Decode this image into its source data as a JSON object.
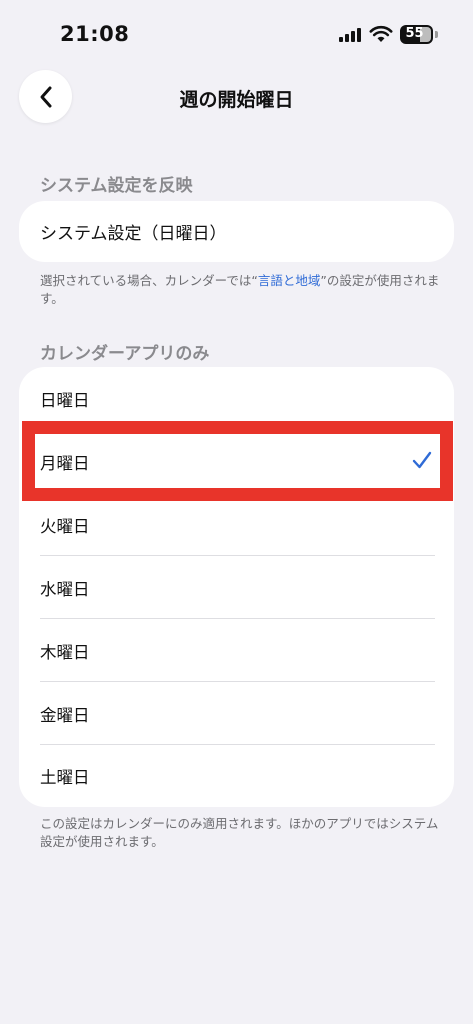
{
  "status": {
    "time": "21:08",
    "battery": "55"
  },
  "nav": {
    "title": "週の開始曜日"
  },
  "system_section": {
    "header": "システム設定を反映",
    "option": "システム設定（日曜日）",
    "footnote_before": "選択されている場合、カレンダーでは“",
    "footnote_link": "言語と地域",
    "footnote_after": "”の設定が使用されます。"
  },
  "calendar_section": {
    "header": "カレンダーアプリのみ",
    "days": [
      "日曜日",
      "月曜日",
      "火曜日",
      "水曜日",
      "木曜日",
      "金曜日",
      "土曜日"
    ],
    "selected": "月曜日",
    "footnote": "この設定はカレンダーにのみ適用されます。ほかのアプリではシステム設定が使用されます。"
  },
  "colors": {
    "accent": "#2f6bd6",
    "highlight": "#e8342a",
    "background": "#f2f1f6"
  }
}
